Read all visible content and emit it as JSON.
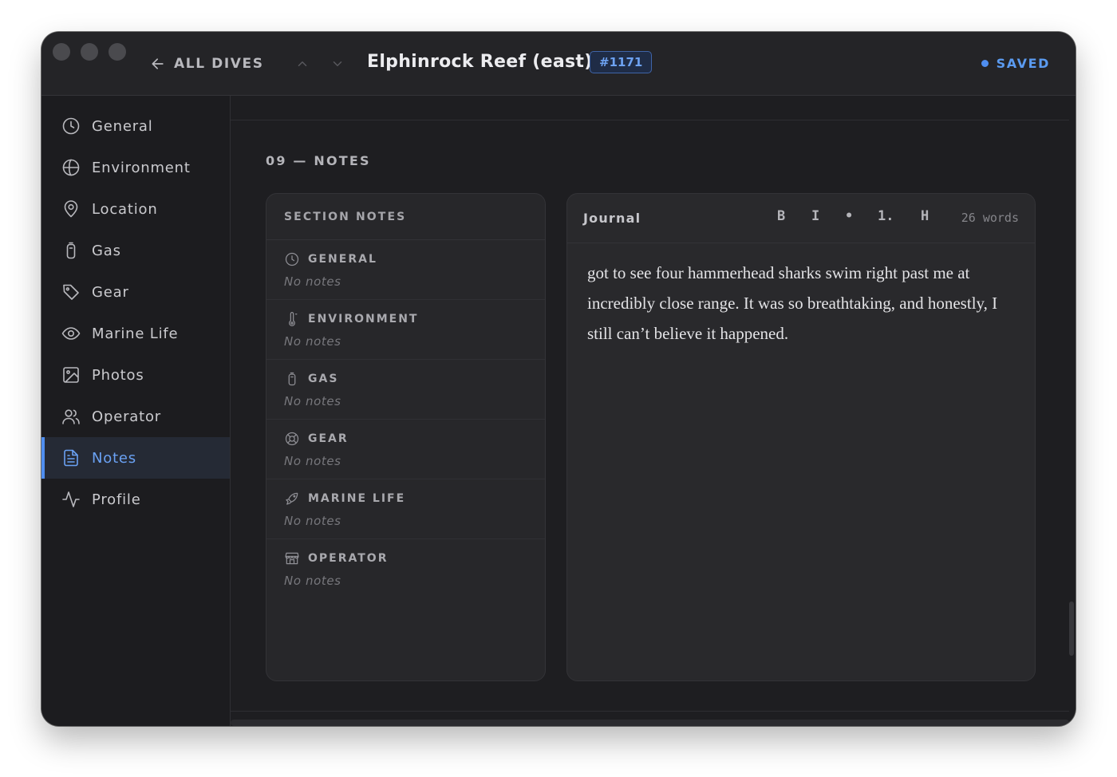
{
  "window": {
    "back_label": "ALL DIVES",
    "title": "Elphinrock Reef (east)",
    "badge": "#1171",
    "status": "SAVED",
    "accent_color": "#4f8ef0"
  },
  "sidebar": {
    "items": [
      {
        "label": "General",
        "icon": "clock-icon"
      },
      {
        "label": "Environment",
        "icon": "globe-icon"
      },
      {
        "label": "Location",
        "icon": "map-pin-icon"
      },
      {
        "label": "Gas",
        "icon": "cylinder-icon"
      },
      {
        "label": "Gear",
        "icon": "tag-icon"
      },
      {
        "label": "Marine Life",
        "icon": "eye-icon"
      },
      {
        "label": "Photos",
        "icon": "image-icon"
      },
      {
        "label": "Operator",
        "icon": "users-icon"
      },
      {
        "label": "Notes",
        "icon": "document-icon",
        "active": true
      },
      {
        "label": "Profile",
        "icon": "activity-icon"
      }
    ]
  },
  "main": {
    "heading": "09 — NOTES",
    "section_notes": {
      "title": "SECTION NOTES",
      "rows": [
        {
          "label": "GENERAL",
          "icon": "clock-icon",
          "value": "No notes"
        },
        {
          "label": "ENVIRONMENT",
          "icon": "thermometer-icon",
          "value": "No notes"
        },
        {
          "label": "GAS",
          "icon": "cylinder-icon",
          "value": "No notes"
        },
        {
          "label": "GEAR",
          "icon": "lifebuoy-icon",
          "value": "No notes"
        },
        {
          "label": "MARINE LIFE",
          "icon": "fish-icon",
          "value": "No notes"
        },
        {
          "label": "OPERATOR",
          "icon": "store-icon",
          "value": "No notes"
        }
      ]
    },
    "journal": {
      "title": "Journal",
      "toolbar": {
        "bold": "B",
        "italic": "I",
        "bullet": "•",
        "numbered": "1.",
        "heading": "H"
      },
      "word_count": "26 words",
      "text": "got to see four hammerhead sharks swim right past me at incredibly close range. It was so breathtaking, and honestly, I still can’t believe it happened."
    }
  }
}
